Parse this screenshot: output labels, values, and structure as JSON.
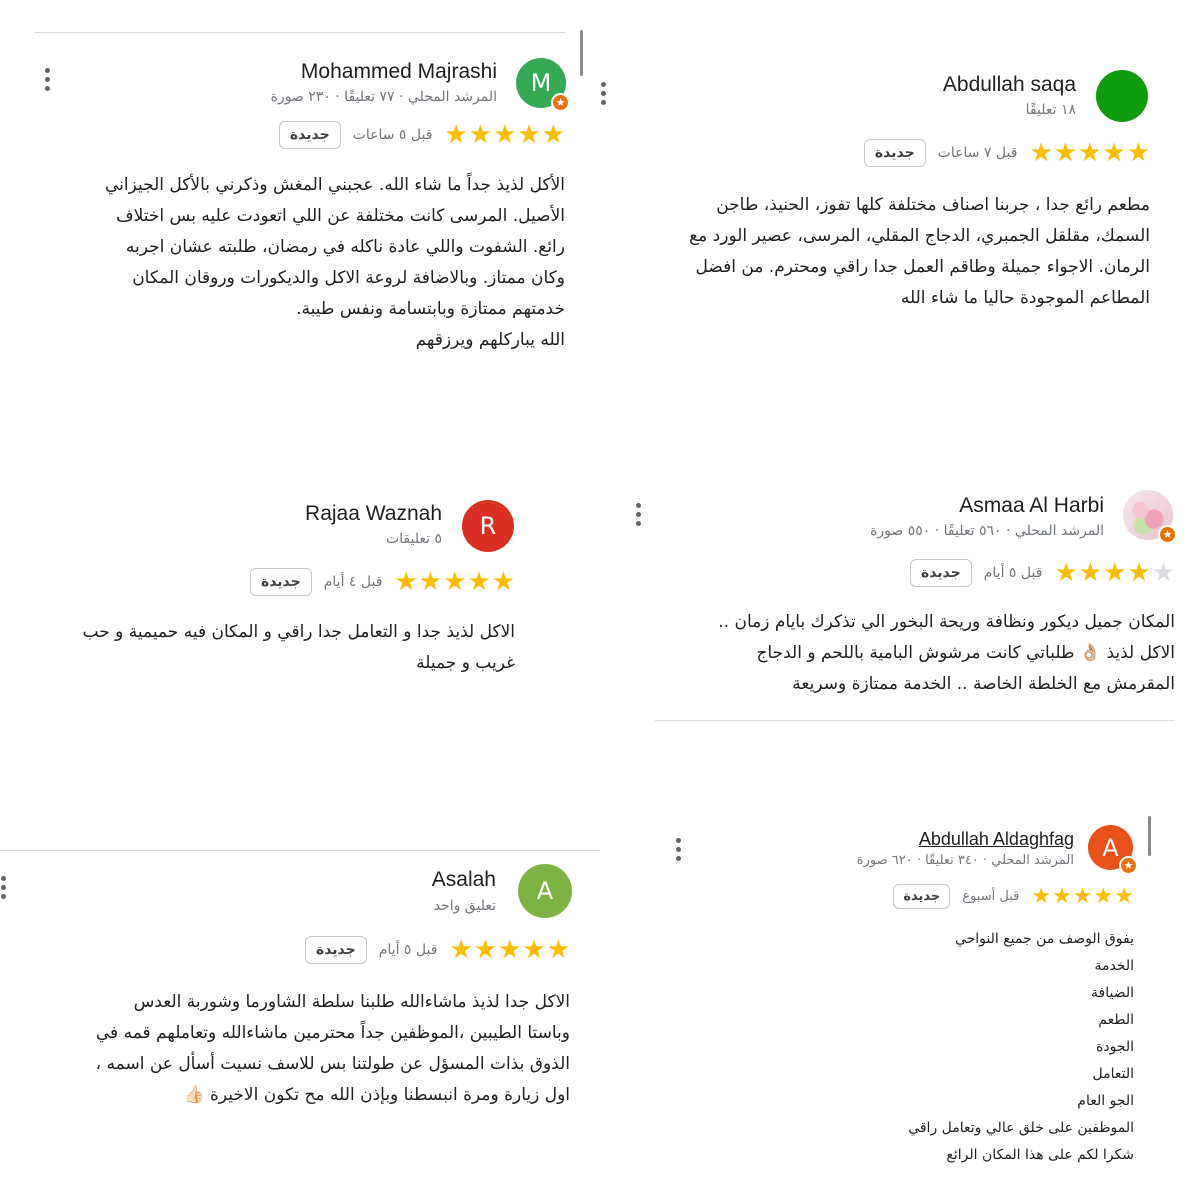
{
  "reviews": [
    {
      "name": "Mohammed Majrashi",
      "avatar_letter": "M",
      "avatar_color": "#34a853",
      "local_guide": true,
      "meta": "المرشد المحلي · ٧٧ تعليقًا · ٢٣٠ صورة",
      "stars": 5,
      "time": "قبل ٥ ساعات",
      "badge": "جديدة",
      "lines": [
        "الأكل لذيذ جداً ما شاء الله. عجبني المغش وذكرني بالأكل الجيزاني",
        "الأصيل. المرسى كانت مختلفة عن اللي اتعودت عليه بس اختلاف",
        "رائع. الشفوت واللي عادة ناكله في رمضان، طلبته عشان اجربه",
        "وكان ممتاز. وبالاضافة لروعة الاكل والديكورات وروقان المكان",
        "خدمتهم ممتازة وبابتسامة ونفس طيبة.",
        "الله يباركلهم ويرزقهم"
      ]
    },
    {
      "name": "Abdullah saqa",
      "avatar_letter": "",
      "avatar_color": "#0f9d0f",
      "local_guide": false,
      "meta": "١٨ تعليقًا",
      "stars": 5,
      "time": "قبل ٧ ساعات",
      "badge": "جديدة",
      "lines": [
        "مطعم رائع جدا ، جربنا اصناف مختلفة كلها تفوز، الحنيذ، طاجن",
        "السمك، مقلقل الجمبري، الدجاج المقلي، المرسى، عصير الورد مع",
        "الرمان. الاجواء جميلة وطاقم العمل جدا راقي ومحترم. من افضل",
        "المطاعم الموجودة حاليا ما شاء الله"
      ]
    },
    {
      "name": "Rajaa Waznah",
      "avatar_letter": "R",
      "avatar_color": "#d93025",
      "local_guide": false,
      "meta": "٥ تعليقات",
      "stars": 5,
      "time": "قبل ٤ أيام",
      "badge": "جديدة",
      "lines": [
        "الاكل لذيذ جدا و التعامل جدا راقي و المكان فيه حميمية و حب",
        "غريب و جميلة"
      ]
    },
    {
      "name": "Asmaa Al Harbi",
      "avatar_letter": "",
      "avatar_color": "#f2c6d2",
      "local_guide": true,
      "meta": "المرشد المحلي · ٥٦٠ تعليقًا · ٥٥٠ صورة",
      "stars": 4,
      "time": "قبل ٥ أيام",
      "badge": "جديدة",
      "lines": [
        "المكان جميل ديكور ونظافة وريحة البخور الي تذكرك بايام زمان ..",
        "الاكل لذيذ 👌🏼 طلباتي كانت مرشوش البامية باللحم و الدجاج",
        "المقرمش مع الخلطة الخاصة .. الخدمة ممتازة وسريعة"
      ]
    },
    {
      "name": "Asalah",
      "avatar_letter": "A",
      "avatar_color": "#7cb342",
      "local_guide": false,
      "meta": "تعليق واحد",
      "stars": 5,
      "time": "قبل ٥ أيام",
      "badge": "جديدة",
      "lines": [
        "الاكل جدا لذيذ ماشاءالله طلبنا سلطة الشاورما وشوربة العدس",
        "وباستا الطيبين ،الموظفين جداً محترمين ماشاءالله وتعاملهم قمه في",
        "الذوق بذات المسؤل عن طولتنا بس للاسف نسيت أسأل عن اسمه ،",
        "اول زيارة ومرة انبسطنا وبإذن الله مح تكون الاخيرة 👍🏻"
      ]
    },
    {
      "name": "Abdullah Aldaghfag",
      "avatar_letter": "A",
      "avatar_color": "#e8511a",
      "local_guide": true,
      "meta": "المرشد المحلي · ٣٤٠ تعليقًا · ٦٢٠ صورة",
      "stars": 5,
      "time": "قبل أسبوع",
      "badge": "جديدة",
      "lines": [
        "يفوق الوصف من جميع النواحي",
        "الخدمة",
        "الضيافة",
        "الطعم",
        "الجودة",
        "التعامل",
        "الجو العام",
        "الموظفين على خلق عالي وتعامل راقي",
        "شكرا لكم على هذا المكان الرائع"
      ]
    }
  ],
  "guide_badge_glyph": "★",
  "star_glyph": "★",
  "more_icon": "more-vertical-icon"
}
